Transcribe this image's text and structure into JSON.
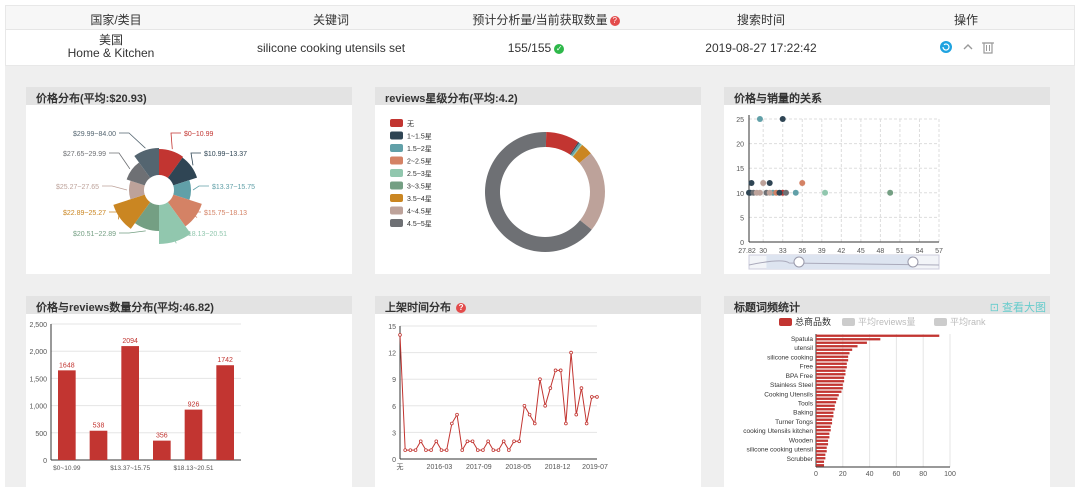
{
  "table": {
    "headers": [
      "国家/类目",
      "关键词",
      "预计分析量/当前获取数量",
      "搜索时间",
      "操作"
    ],
    "row": {
      "country": "美国",
      "category": "Home & Kitchen",
      "keyword": "silicone cooking utensils set",
      "count": "155/155",
      "time": "2019-08-27 17:22:42"
    },
    "icons": {
      "refresh": "refresh-icon",
      "collapse": "chevron-up-icon",
      "delete": "trash-icon",
      "help": "question-icon",
      "ok": "check-icon"
    }
  },
  "panels": {
    "price_dist": {
      "title": "价格分布(平均:$20.93)"
    },
    "reviews_star": {
      "title": "reviews星级分布(平均:4.2)"
    },
    "price_sales": {
      "title": "价格与销量的关系"
    },
    "price_reviews": {
      "title": "价格与reviews数量分布(平均:46.82)"
    },
    "listing_time": {
      "title": "上架时间分布"
    },
    "title_words": {
      "title": "标题词频统计",
      "link": "查看大图"
    }
  },
  "chart_data": [
    {
      "type": "pie",
      "variant": "rose",
      "categories": [
        "$0~10.99",
        "$10.99~13.37",
        "$13.37~15.75",
        "$15.75~18.13",
        "$18.13~20.51",
        "$20.51~22.89",
        "$22.89~25.27",
        "$25.27~27.65",
        "$27.65~29.99",
        "$29.99~84.00"
      ],
      "values": [
        1648,
        538,
        2094,
        356,
        926,
        1742,
        2094,
        1100,
        1000,
        1648
      ],
      "colors": [
        "#c23531",
        "#2f4554",
        "#61a0a8",
        "#d48265",
        "#91c7ae",
        "#749f83",
        "#ca8622",
        "#bda29a",
        "#6e7074",
        "#546570"
      ],
      "radii": [
        26,
        25,
        17,
        30,
        39,
        26,
        33,
        15,
        19,
        27
      ]
    },
    {
      "type": "pie",
      "variant": "donut",
      "categories": [
        "无",
        "1~1.5星",
        "1.5~2星",
        "2~2.5星",
        "2.5~3星",
        "3~3.5星",
        "3.5~4星",
        "4~4.5星",
        "4.5~5星"
      ],
      "values": [
        14,
        0.5,
        1,
        0,
        0.5,
        0,
        5,
        34,
        100
      ],
      "colors": [
        "#c23531",
        "#2f4554",
        "#61a0a8",
        "#d48265",
        "#91c7ae",
        "#749f83",
        "#ca8622",
        "#bda29a",
        "#6e7074"
      ]
    },
    {
      "type": "scatter",
      "x": [
        27.82,
        28,
        28.2,
        28.5,
        29,
        29.5,
        30,
        30.5,
        31,
        31.5,
        32,
        33,
        33,
        33.5,
        35,
        36,
        39.5,
        49.5,
        29.5,
        31,
        32.5
      ],
      "y": [
        10,
        10,
        12,
        10,
        10,
        10,
        12,
        10,
        12,
        10,
        10,
        25,
        10,
        10,
        10,
        12,
        10,
        10,
        25,
        10,
        10
      ],
      "colors": [
        "#2f4554",
        "#2f4554",
        "#2f4554",
        "#6e7074",
        "#bda29a",
        "#bda29a",
        "#bda29a",
        "#6e7074",
        "#2f4554",
        "#61a0a8",
        "#d48265",
        "#2f4554",
        "#c23531",
        "#6e7074",
        "#61a0a8",
        "#d48265",
        "#91c7ae",
        "#749f83",
        "#61a0a8",
        "#bda29a",
        "#2f4554"
      ],
      "xticks": [
        "27.82",
        "30",
        "33",
        "36",
        "39",
        "42",
        "45",
        "48",
        "51",
        "54",
        "57"
      ],
      "yticks": [
        "0",
        "5",
        "10",
        "15",
        "20",
        "25"
      ],
      "xlim": [
        27.82,
        57
      ],
      "ylim": [
        0,
        25
      ]
    },
    {
      "type": "bar",
      "categories": [
        "$0~10.99",
        "",
        "$13.37~15.75",
        "",
        "$18.13~20.51",
        ""
      ],
      "values": [
        1648,
        538,
        2094,
        356,
        926,
        1742
      ],
      "ylim": [
        0,
        2500
      ],
      "yticks": [
        "0",
        "500",
        "1,000",
        "1,500",
        "2,000",
        "2,500"
      ],
      "color": "#c23531"
    },
    {
      "type": "line",
      "values": [
        14,
        1,
        1,
        1,
        2,
        1,
        1,
        2,
        1,
        1,
        4,
        5,
        1,
        2,
        2,
        1,
        1,
        2,
        1,
        1,
        2,
        1,
        2,
        2,
        6,
        5,
        4,
        9,
        6,
        8,
        10,
        10,
        4,
        12,
        5,
        8,
        4,
        7,
        7
      ],
      "xticks": [
        "无",
        "2016-03",
        "2017-09",
        "2018-05",
        "2018-12",
        "2019-07"
      ],
      "yticks": [
        "0",
        "3",
        "6",
        "9",
        "12",
        "15"
      ],
      "ylim": [
        0,
        15
      ],
      "color": "#c23531"
    },
    {
      "type": "bar",
      "orientation": "horizontal",
      "legend": [
        "总商品数",
        "平均reviews量",
        "平均rank"
      ],
      "labels": [
        "Spatula",
        "utensil",
        "silicone cooking",
        "Free",
        "BPA Free",
        "Stainless Steel",
        "Cooking Utensils",
        "Tools",
        "Baking",
        "Turner Tongs",
        "cooking Utensils kitchen",
        "Wooden",
        "silicone cooking utensil",
        "Scrubber"
      ],
      "values": [
        92,
        48,
        38,
        31,
        27,
        25,
        24,
        24,
        23,
        23,
        22,
        22,
        21,
        21,
        20,
        20,
        19,
        17,
        16,
        15,
        14,
        14,
        13,
        13,
        12,
        12,
        11,
        11,
        10,
        10,
        9,
        9,
        8,
        8,
        7,
        7,
        6,
        6
      ],
      "xticks": [
        "0",
        "20",
        "40",
        "60",
        "80",
        "100"
      ],
      "xlim": [
        0,
        100
      ],
      "color": "#c23531"
    }
  ]
}
